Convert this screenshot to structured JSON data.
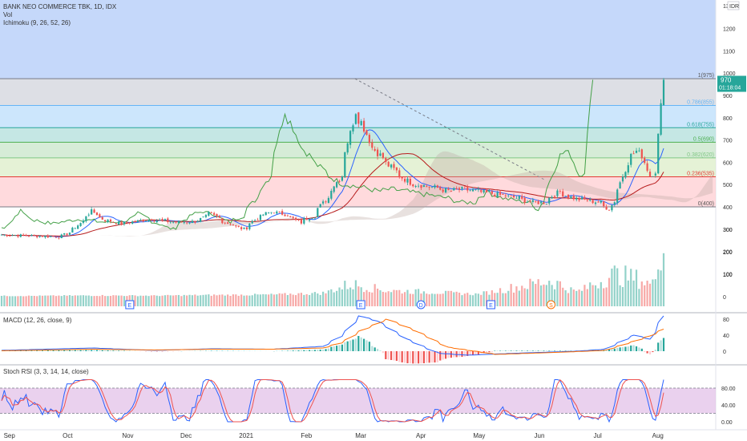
{
  "header": {
    "title": "BANK NEO COMMERCE TBK, 1D, IDX",
    "volume_label": "Vol",
    "ichimoku_label": "Ichimoku (9, 26, 52, 26)",
    "currency": "IDR",
    "top_count": "13"
  },
  "colors": {
    "up": "#26a69a",
    "down": "#ef5350",
    "macd": "#2962ff",
    "signal": "#ff6d00",
    "stoch_k": "#2962ff",
    "stoch_d": "#ef5350",
    "stoch_band": "#e1bee7",
    "fib_1": "#d1d4dc",
    "fib_786": "#bbdefb",
    "fib_618": "#b2dfdb",
    "fib_5": "#c8e6c9",
    "fib_382": "#dcedc8",
    "fib_236": "#ffcdd2",
    "sky": "#c5d8fa",
    "price_badge": "#26a69a"
  },
  "price_badge": {
    "price": "970",
    "countdown": "01:18:04"
  },
  "chart_data": [
    {
      "type": "candlestick",
      "name": "price",
      "ylim": [
        100,
        1300
      ],
      "yticks": [
        100,
        200,
        300,
        400,
        500,
        600,
        700,
        800,
        900,
        1000,
        1100,
        1200
      ],
      "x_labels": [
        "Sep",
        "Oct",
        "Nov",
        "Dec",
        "2021",
        "Feb",
        "Mar",
        "Apr",
        "May",
        "Jun",
        "Jul",
        "Aug"
      ],
      "fibonacci": [
        {
          "label": "1(975)",
          "ratio": "1",
          "value": 975
        },
        {
          "label": "0.786(855)",
          "ratio": "0.786",
          "value": 855
        },
        {
          "label": "0.618(755)",
          "ratio": "0.618",
          "value": 755
        },
        {
          "label": "0.5(690)",
          "ratio": "0.5",
          "value": 690
        },
        {
          "label": "0.382(620)",
          "ratio": "0.382",
          "value": 620
        },
        {
          "label": "0.236(535)",
          "ratio": "0.236",
          "value": 535
        },
        {
          "label": "0(400)",
          "ratio": "0",
          "value": 400
        }
      ],
      "close_path": [
        [
          "2020-08-28",
          275
        ],
        [
          "2020-09-14",
          270
        ],
        [
          "2020-09-28",
          265
        ],
        [
          "2020-10-05",
          300
        ],
        [
          "2020-10-14",
          380
        ],
        [
          "2020-10-21",
          340
        ],
        [
          "2020-10-30",
          325
        ],
        [
          "2020-11-13",
          345
        ],
        [
          "2020-11-27",
          330
        ],
        [
          "2020-12-07",
          335
        ],
        [
          "2020-12-14",
          370
        ],
        [
          "2020-12-22",
          330
        ],
        [
          "2020-12-31",
          300
        ],
        [
          "2021-01-08",
          355
        ],
        [
          "2021-01-15",
          380
        ],
        [
          "2021-01-22",
          365
        ],
        [
          "2021-01-29",
          330
        ],
        [
          "2021-02-05",
          360
        ],
        [
          "2021-02-12",
          440
        ],
        [
          "2021-02-19",
          540
        ],
        [
          "2021-02-24",
          730
        ],
        [
          "2021-02-26",
          830
        ],
        [
          "2021-03-02",
          780
        ],
        [
          "2021-03-05",
          700
        ],
        [
          "2021-03-12",
          620
        ],
        [
          "2021-03-19",
          560
        ],
        [
          "2021-03-26",
          510
        ],
        [
          "2021-04-02",
          495
        ],
        [
          "2021-04-09",
          485
        ],
        [
          "2021-04-16",
          470
        ],
        [
          "2021-04-23",
          480
        ],
        [
          "2021-04-30",
          470
        ],
        [
          "2021-05-07",
          460
        ],
        [
          "2021-05-14",
          450
        ],
        [
          "2021-05-21",
          440
        ],
        [
          "2021-05-28",
          420
        ],
        [
          "2021-06-04",
          420
        ],
        [
          "2021-06-11",
          470
        ],
        [
          "2021-06-18",
          440
        ],
        [
          "2021-06-25",
          430
        ],
        [
          "2021-07-02",
          420
        ],
        [
          "2021-07-07",
          390
        ],
        [
          "2021-07-12",
          480
        ],
        [
          "2021-07-16",
          600
        ],
        [
          "2021-07-21",
          650
        ],
        [
          "2021-07-26",
          600
        ],
        [
          "2021-07-28",
          540
        ],
        [
          "2021-07-30",
          560
        ],
        [
          "2021-08-02",
          720
        ],
        [
          "2021-08-03",
          850
        ],
        [
          "2021-08-04",
          970
        ]
      ],
      "last_price": 970
    },
    {
      "type": "bar",
      "name": "volume",
      "unit": "M",
      "yticks": [
        0,
        100,
        200,
        300
      ],
      "event_markers": [
        {
          "label": "E",
          "date": "2020-11-02"
        },
        {
          "label": "E",
          "date": "2021-03-01"
        },
        {
          "label": "D",
          "date": "2021-04-01"
        },
        {
          "label": "E",
          "date": "2021-05-07"
        },
        {
          "label": "S",
          "date": "2021-06-07"
        }
      ],
      "volume_path": [
        [
          "2020-09-15",
          4
        ],
        [
          "2020-10-15",
          6
        ],
        [
          "2020-11-15",
          5
        ],
        [
          "2020-12-15",
          8
        ],
        [
          "2021-01-15",
          10
        ],
        [
          "2021-02-10",
          18
        ],
        [
          "2021-02-24",
          60
        ],
        [
          "2021-03-01",
          55
        ],
        [
          "2021-03-15",
          30
        ],
        [
          "2021-04-01",
          25
        ],
        [
          "2021-05-01",
          12
        ],
        [
          "2021-06-07",
          80
        ],
        [
          "2021-06-20",
          20
        ],
        [
          "2021-07-09",
          110
        ],
        [
          "2021-07-21",
          90
        ],
        [
          "2021-07-29",
          60
        ],
        [
          "2021-08-02",
          260
        ],
        [
          "2021-08-04",
          250
        ]
      ]
    },
    {
      "type": "line",
      "name": "MACD",
      "title": "MACD (12, 26, close, 9)",
      "yticks": [
        0,
        40,
        80
      ],
      "series": [
        {
          "name": "MACD",
          "points": [
            [
              "2020-08-28",
              2
            ],
            [
              "2020-10-15",
              8
            ],
            [
              "2020-11-15",
              2
            ],
            [
              "2020-12-15",
              6
            ],
            [
              "2021-01-15",
              5
            ],
            [
              "2021-02-10",
              12
            ],
            [
              "2021-02-20",
              40
            ],
            [
              "2021-03-01",
              88
            ],
            [
              "2021-03-10",
              75
            ],
            [
              "2021-03-25",
              30
            ],
            [
              "2021-04-10",
              -5
            ],
            [
              "2021-04-25",
              -10
            ],
            [
              "2021-05-20",
              -5
            ],
            [
              "2021-06-20",
              0
            ],
            [
              "2021-07-05",
              5
            ],
            [
              "2021-07-20",
              40
            ],
            [
              "2021-07-28",
              30
            ],
            [
              "2021-08-04",
              88
            ]
          ]
        },
        {
          "name": "Signal",
          "points": [
            [
              "2020-08-28",
              1
            ],
            [
              "2020-10-15",
              5
            ],
            [
              "2020-11-15",
              3
            ],
            [
              "2020-12-15",
              5
            ],
            [
              "2021-01-15",
              5
            ],
            [
              "2021-02-10",
              8
            ],
            [
              "2021-02-20",
              22
            ],
            [
              "2021-03-01",
              50
            ],
            [
              "2021-03-15",
              80
            ],
            [
              "2021-03-30",
              50
            ],
            [
              "2021-04-15",
              10
            ],
            [
              "2021-05-10",
              -8
            ],
            [
              "2021-06-15",
              -2
            ],
            [
              "2021-07-05",
              2
            ],
            [
              "2021-07-20",
              25
            ],
            [
              "2021-07-28",
              38
            ],
            [
              "2021-08-04",
              55
            ]
          ]
        }
      ]
    },
    {
      "type": "line",
      "name": "Stoch RSI",
      "title": "Stoch RSI (3, 3, 14, 14, close)",
      "yticks": [
        "0.00",
        "40.00",
        "80.00"
      ],
      "band": [
        20,
        80
      ],
      "ylim": [
        -10,
        110
      ]
    }
  ]
}
